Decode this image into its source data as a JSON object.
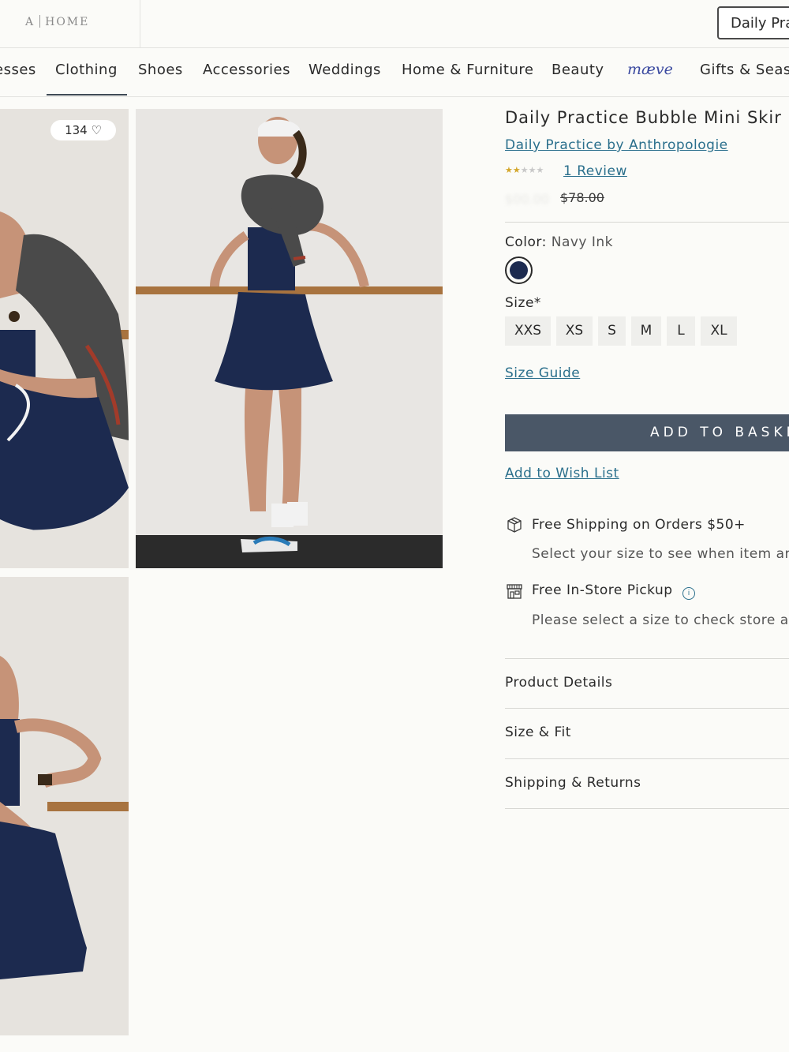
{
  "header": {
    "logo_left": "A",
    "logo_right": "HOME",
    "search_value": "Daily Pra"
  },
  "nav": {
    "items": [
      "esses",
      "Clothing",
      "Shoes",
      "Accessories",
      "Weddings",
      "Home & Furniture",
      "Beauty",
      "mæve",
      "Gifts & Seas"
    ],
    "active": "Clothing"
  },
  "gallery": {
    "wish_count": "134 ♡"
  },
  "product": {
    "title": "Daily Practice Bubble Mini Skir",
    "brand": "Daily Practice by Anthropologie",
    "rating": 2,
    "rating_max": 5,
    "review_link": "1 Review",
    "original_price": "$78.00",
    "color_label": "Color:",
    "color_value": "Navy Ink",
    "swatch_color": "#1c2a4f",
    "size_label": "Size*",
    "sizes": [
      "XXS",
      "XS",
      "S",
      "M",
      "L",
      "XL"
    ],
    "size_guide": "Size Guide",
    "add_to_basket": "ADD TO BASKE",
    "wish_list": "Add to Wish List"
  },
  "fulfillment": {
    "shipping_title": "Free Shipping on Orders $50+",
    "shipping_sub": "Select your size to see when item arr",
    "pickup_title": "Free In-Store Pickup",
    "pickup_info_icon": "i",
    "pickup_sub": "Please select a size to check store av"
  },
  "accordions": [
    "Product Details",
    "Size & Fit",
    "Shipping & Returns"
  ],
  "colors": {
    "link": "#2a6f8c",
    "button": "#4a5767",
    "navy": "#1c2a4f",
    "star": "#d4a72c"
  }
}
